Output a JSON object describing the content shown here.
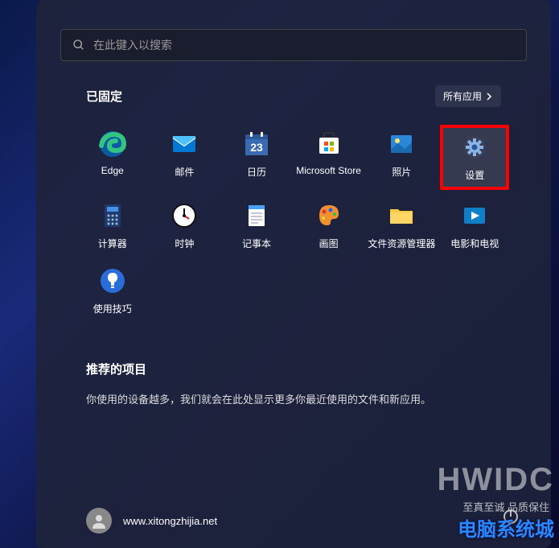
{
  "search": {
    "placeholder": "在此键入以搜索"
  },
  "pinned": {
    "title": "已固定",
    "all_apps": "所有应用",
    "apps": [
      {
        "label": "Edge"
      },
      {
        "label": "邮件"
      },
      {
        "label": "日历"
      },
      {
        "label": "Microsoft Store"
      },
      {
        "label": "照片"
      },
      {
        "label": "设置"
      },
      {
        "label": "计算器"
      },
      {
        "label": "时钟"
      },
      {
        "label": "记事本"
      },
      {
        "label": "画图"
      },
      {
        "label": "文件资源管理器"
      },
      {
        "label": "电影和电视"
      },
      {
        "label": "使用技巧"
      }
    ]
  },
  "recommended": {
    "title": "推荐的项目",
    "text": "你使用的设备越多，我们就会在此处显示更多你最近使用的文件和新应用。"
  },
  "user": {
    "name": "www.xitongzhijia.net"
  },
  "watermark": "HWIDC",
  "credit": "至真至诚 品质保住",
  "brand": "电脑系统城"
}
